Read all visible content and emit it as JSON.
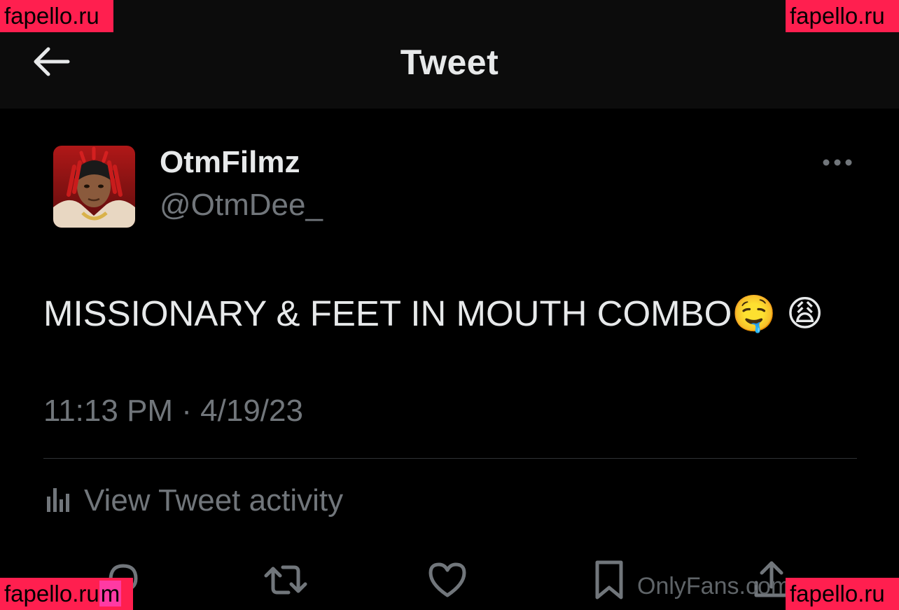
{
  "header": {
    "title": "Tweet",
    "back_icon": "arrow-left-icon"
  },
  "author": {
    "display_name": "OtmFilmz",
    "handle": "@OtmDee_"
  },
  "tweet": {
    "text": "MISSIONARY & FEET IN MOUTH COMBO🤤 😩",
    "timestamp": "11:13 PM · 4/19/23"
  },
  "activity": {
    "label": "View Tweet activity",
    "icon": "bar-chart-icon"
  },
  "actions": [
    {
      "icon": "reply-icon"
    },
    {
      "icon": "retweet-icon"
    },
    {
      "icon": "like-icon"
    },
    {
      "icon": "bookmark-icon"
    },
    {
      "icon": "share-icon"
    }
  ],
  "watermarks": {
    "top_left": "fapello.ru",
    "top_right": "fapello.ru",
    "bottom_left": "fapello.ru",
    "bottom_left_suffix": "m",
    "bottom_right": "fapello.ru",
    "onlyfans": "OnlyFans.com"
  },
  "colors": {
    "background": "#000000",
    "header_bg": "#0c0c0c",
    "primary_text": "#e7e9ea",
    "secondary_text": "#71767b",
    "divider": "#2f3336",
    "watermark_bg": "#ff1f4f"
  }
}
